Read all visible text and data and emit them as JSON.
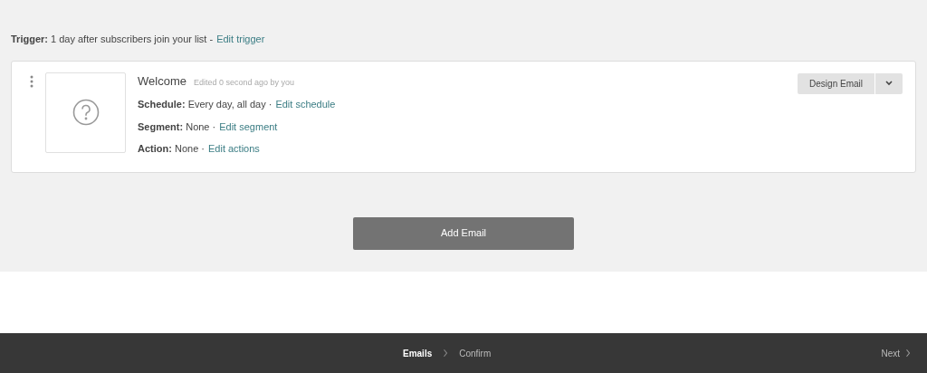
{
  "trigger": {
    "label": "Trigger:",
    "value": "1 day after subscribers join your list -",
    "link": "Edit trigger"
  },
  "emails": [
    {
      "name": "Welcome",
      "edited": "Edited 0 second ago by you",
      "details": [
        {
          "label": "Schedule:",
          "value": "Every day, all day ·",
          "link": "Edit schedule"
        },
        {
          "label": "Segment:",
          "value": "None ·",
          "link": "Edit segment"
        },
        {
          "label": "Action:",
          "value": "None ·",
          "link": "Edit actions"
        }
      ],
      "design_button": "Design Email"
    }
  ],
  "add_button": "Add Email",
  "footer": {
    "steps": [
      {
        "label": "Emails",
        "selected": true
      },
      {
        "label": "Confirm",
        "selected": false
      }
    ],
    "next": "Next"
  }
}
